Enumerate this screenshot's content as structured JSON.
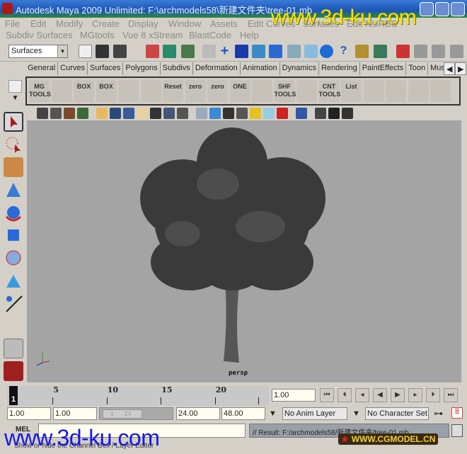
{
  "window": {
    "title": "Autodesk Maya 2009 Unlimited: F:\\archmodels58\\新建文件夹\\tree-01.mb"
  },
  "watermark": {
    "top": "www.3d-ku.com",
    "bottom": "www.3d-ku.com",
    "logo": "WWW.CGMODEL.CN"
  },
  "menu": {
    "row1": [
      "File",
      "Edit",
      "Modify",
      "Create",
      "Display",
      "Window",
      "Assets",
      "Edit Curves",
      "Surfaces",
      "Edit NURBS"
    ],
    "row2": [
      "Subdiv Surfaces",
      "MGtools",
      "Vue 8 xStream",
      "BlastCode",
      "Help"
    ]
  },
  "status": {
    "menu_set": "Surfaces"
  },
  "shelf_tabs": [
    "General",
    "Curves",
    "Surfaces",
    "Polygons",
    "Subdivs",
    "Deformation",
    "Animation",
    "Dynamics",
    "Rendering",
    "PaintEffects",
    "Toon",
    "Musc"
  ],
  "shelf": [
    "MG TOOLS",
    "",
    "BOX",
    "BOX",
    "",
    "",
    "Reset",
    "zero",
    "zero",
    "ONE",
    "",
    "SHF TOOLS",
    "",
    "CNT TOOLS",
    "List",
    "",
    "",
    "",
    ""
  ],
  "viewport": {
    "camera": "persp",
    "object": "tree"
  },
  "timeline": {
    "ticks": [
      "1",
      "5",
      "10",
      "15",
      "20"
    ],
    "current": "1",
    "current_time": "1.00"
  },
  "range": {
    "start": "1.00",
    "playback_start": "1.00",
    "range_slider_start": "1",
    "range_slider_end": "24",
    "playback_end": "24.00",
    "end": "48.00",
    "anim_layer": "No Anim Layer",
    "character_set": "No Character Set"
  },
  "command": {
    "label": "MEL",
    "input": "",
    "result": "// Result: F:/archmodels58/新建文件夹/tree-01.mb"
  },
  "help_line": "Show or hide the Channel Box / Layer Editor",
  "colors": {
    "viewport_bg": "#a4a4a4",
    "panel_bg": "#d4d0c8"
  }
}
